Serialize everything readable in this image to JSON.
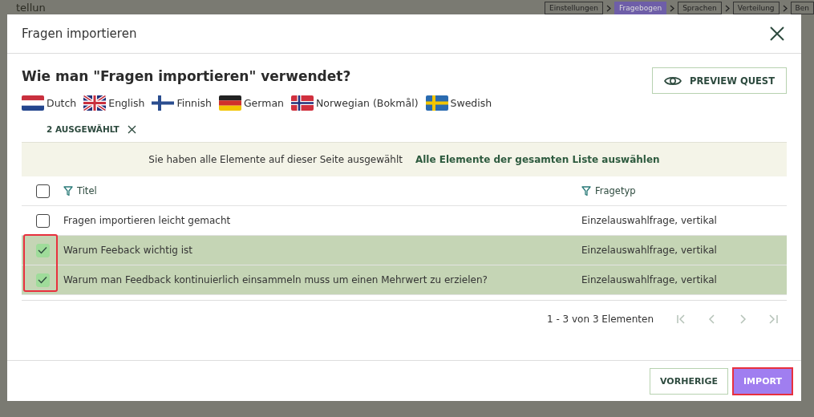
{
  "background": {
    "title": "tellun",
    "steps": [
      {
        "label": "Einstellungen",
        "selected": false
      },
      {
        "label": "Fragebogen",
        "selected": true
      },
      {
        "label": "Sprachen",
        "selected": false
      },
      {
        "label": "Verteilung",
        "selected": false
      },
      {
        "label": "Ben",
        "selected": false
      }
    ]
  },
  "modal": {
    "title": "Fragen importieren",
    "heading": "Wie man \"Fragen importieren\" verwendet?",
    "preview_button": "PREVIEW QUEST",
    "languages": [
      {
        "name": "Dutch",
        "kind": "nl"
      },
      {
        "name": "English",
        "kind": "gb"
      },
      {
        "name": "Finnish",
        "kind": "fi"
      },
      {
        "name": "German",
        "kind": "de"
      },
      {
        "name": "Norwegian (Bokmål)",
        "kind": "no"
      },
      {
        "name": "Swedish",
        "kind": "se"
      }
    ],
    "selection": {
      "count": "2 AUSGEWÄHLT"
    },
    "banner": {
      "text": "Sie haben alle Elemente auf dieser Seite ausgewählt",
      "link": "Alle Elemente der gesamten Liste auswählen"
    },
    "table": {
      "select_all_checked": false,
      "checkbox_highlight": true,
      "columns": [
        "Titel",
        "Fragetyp"
      ],
      "rows": [
        {
          "title": "Fragen importieren leicht gemacht",
          "type": "Einzelauswahlfrage, vertikal",
          "selected": false
        },
        {
          "title": "Warum Feeback wichtig ist",
          "type": "Einzelauswahlfrage, vertikal",
          "selected": true
        },
        {
          "title": "Warum man Feedback kontinuierlich einsammeln muss um einen Mehrwert zu erzielen?",
          "type": "Einzelauswahlfrage, vertikal",
          "selected": true
        }
      ]
    },
    "pagination": {
      "summary": "1 - 3 von 3 Elementen"
    },
    "buttons": [
      {
        "label": "VORHERIGE",
        "kind": "secondary",
        "highlighted": false
      },
      {
        "label": "IMPORT",
        "kind": "primary",
        "highlighted": true
      }
    ]
  }
}
